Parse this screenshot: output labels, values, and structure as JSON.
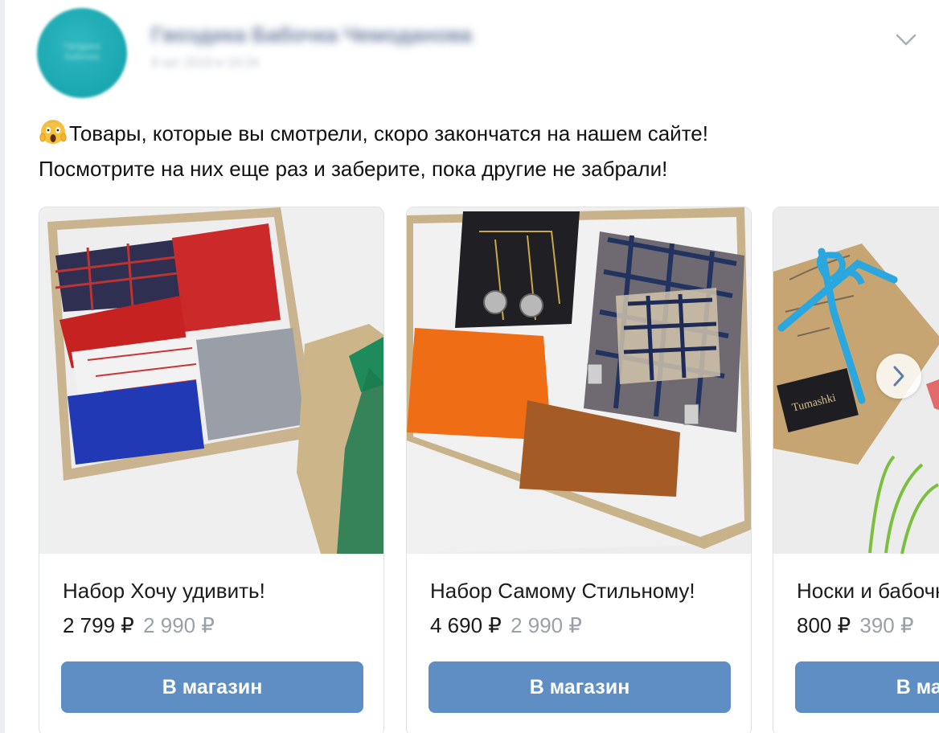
{
  "post": {
    "author": "Гвоздика Бабочка Чемоданова",
    "date": "8 окт 2019 в 10:24",
    "avatar_text": "Гвоздика Бабочка",
    "text_line1": "Товары, которые вы смотрели, скоро закончатся на нашем сайте!",
    "text_line2": "Посмотрите на них еще раз и заберите, пока другие не забрали!",
    "emoji_icon": "face-screaming-in-fear-icon"
  },
  "products": [
    {
      "title": "Набор Хочу удивить!",
      "price": "2 799 ₽",
      "old_price": "2 990 ₽",
      "button": "В магазин"
    },
    {
      "title": "Набор Самому Стильному!",
      "price": "4 690 ₽",
      "old_price": "2 990 ₽",
      "button": "В магазин"
    },
    {
      "title": "Носки и бабочка",
      "price": "800 ₽",
      "old_price": "390 ₽",
      "button": "В магазин"
    }
  ],
  "colors": {
    "button": "#5f8ec4",
    "old_price": "#9aa0a8",
    "avatar": "#1aa7b0"
  },
  "icons": {
    "menu": "chevron-down-icon",
    "carousel_next": "chevron-right-icon"
  }
}
